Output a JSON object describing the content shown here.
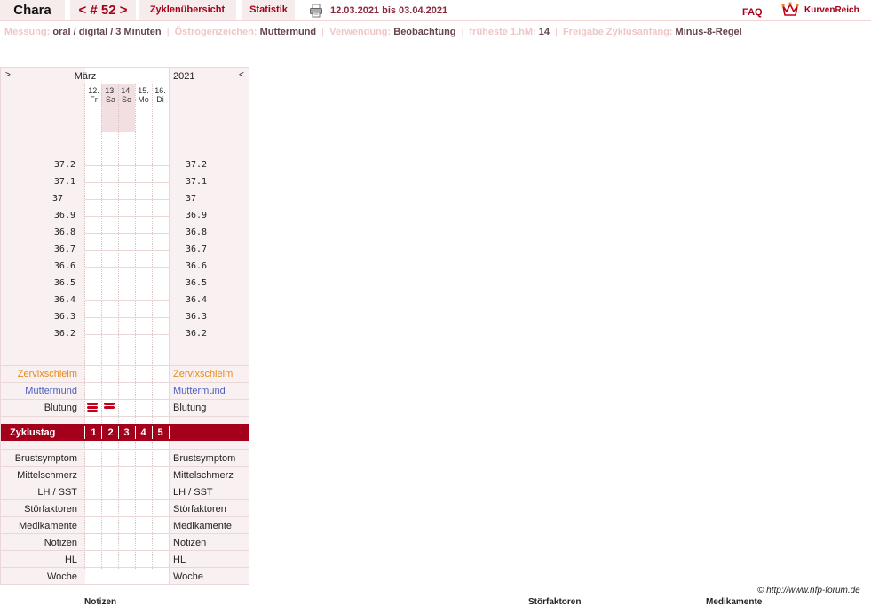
{
  "header": {
    "app_tab": "Chara",
    "cycle_nav": "< # 52 >",
    "overview_tab": "Zyklenübersicht",
    "stats_tab": "Statistik",
    "date_range": "12.03.2021 bis 03.04.2021",
    "faq": "FAQ",
    "logo_text": "KurvenReich"
  },
  "settings": {
    "measure_label": "Messung:",
    "measure_value": "oral / digital / 3 Minuten",
    "estrogen_label": "Östrogenzeichen:",
    "estrogen_value": "Muttermund",
    "use_label": "Verwendung:",
    "use_value": "Beobachtung",
    "earliest_label": "früheste 1.hM:",
    "earliest_value": "14",
    "release_label": "Freigabe Zyklusanfang:",
    "release_value": "Minus-8-Regel"
  },
  "chart": {
    "nav_prev": ">",
    "nav_next": "<",
    "month": "März",
    "year": "2021",
    "days": [
      {
        "date": "12.",
        "weekday": "Fr"
      },
      {
        "date": "13.",
        "weekday": "Sa"
      },
      {
        "date": "14.",
        "weekday": "So"
      },
      {
        "date": "15.",
        "weekday": "Mo"
      },
      {
        "date": "16.",
        "weekday": "Di"
      }
    ],
    "temperatures": [
      "37.2",
      "37.1",
      "37",
      "36.9",
      "36.8",
      "36.7",
      "36.6",
      "36.5",
      "36.4",
      "36.3",
      "36.2"
    ],
    "rows_top": {
      "cervical_mucus": "Zervixschleim",
      "cervix": "Muttermund",
      "bleeding": "Blutung"
    },
    "bleeding_strength": [
      3,
      2,
      0,
      0,
      0
    ],
    "cycle_day_label": "Zyklustag",
    "cycle_days": [
      "1",
      "2",
      "3",
      "4",
      "5"
    ],
    "rows_bottom": [
      "Brustsymptom",
      "Mittelschmerz",
      "LH / SST",
      "Störfaktoren",
      "Medikamente",
      "Notizen",
      "HL",
      "Woche"
    ]
  },
  "footer": {
    "copyright": "© http://www.nfp-forum.de",
    "notes": "Notizen",
    "disturbances": "Störfaktoren",
    "medication": "Medikamente"
  },
  "colors": {
    "accent": "#a5001b",
    "tab_bg": "#f7ecec",
    "muted_label": "#efc6c6",
    "bleeding": "#c4001a"
  }
}
